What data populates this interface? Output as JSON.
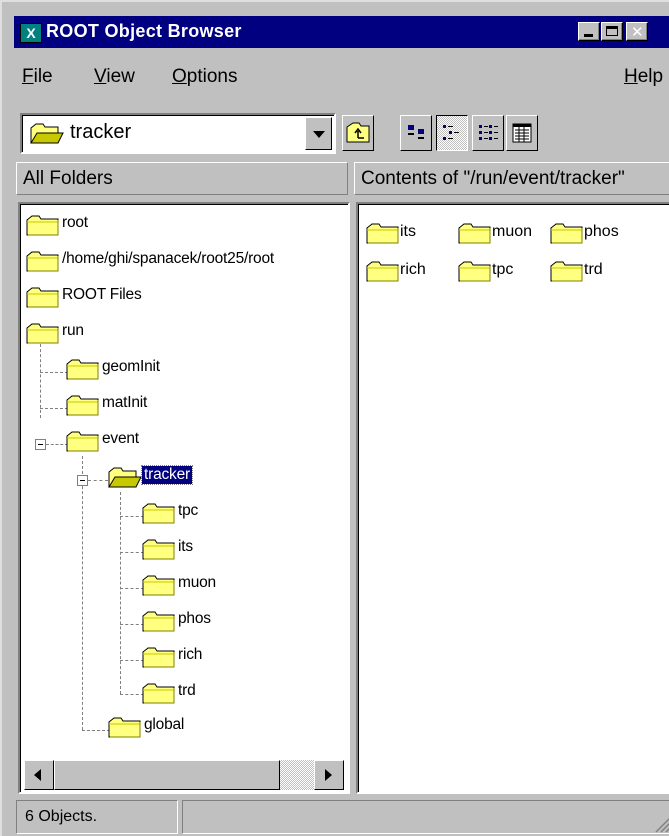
{
  "window": {
    "title": "ROOT Object Browser",
    "icon": "X"
  },
  "menu": {
    "file": {
      "hot": "F",
      "rest": "ile"
    },
    "view": {
      "hot": "V",
      "rest": "iew"
    },
    "options": {
      "hot": "O",
      "rest": "ptions"
    },
    "help": {
      "hot": "H",
      "rest": "elp"
    }
  },
  "location": {
    "value": "tracker"
  },
  "toolbar": {
    "icons": [
      "folder-up-icon",
      "large-icons-icon",
      "small-icons-icon",
      "list-view-icon",
      "details-view-icon"
    ]
  },
  "left_header": "All Folders",
  "right_header": "Contents of \"/run/event/tracker\"",
  "tree": [
    {
      "label": "root"
    },
    {
      "label": "/home/ghi/spanacek/root25/root"
    },
    {
      "label": "ROOT Files"
    },
    {
      "label": "run"
    },
    {
      "label": "geomInit"
    },
    {
      "label": "matInit"
    },
    {
      "label": "event"
    },
    {
      "label": "tracker",
      "selected": true
    },
    {
      "label": "tpc"
    },
    {
      "label": "its"
    },
    {
      "label": "muon"
    },
    {
      "label": "phos"
    },
    {
      "label": "rich"
    },
    {
      "label": "trd"
    },
    {
      "label": "global"
    }
  ],
  "contents": [
    "its",
    "muon",
    "phos",
    "rich",
    "tpc",
    "trd"
  ],
  "status": {
    "text": "6 Objects."
  },
  "colors": {
    "titlebar": "#000080",
    "folder": "#ffff80",
    "face": "#c0c0c0",
    "selection": "#000080"
  }
}
